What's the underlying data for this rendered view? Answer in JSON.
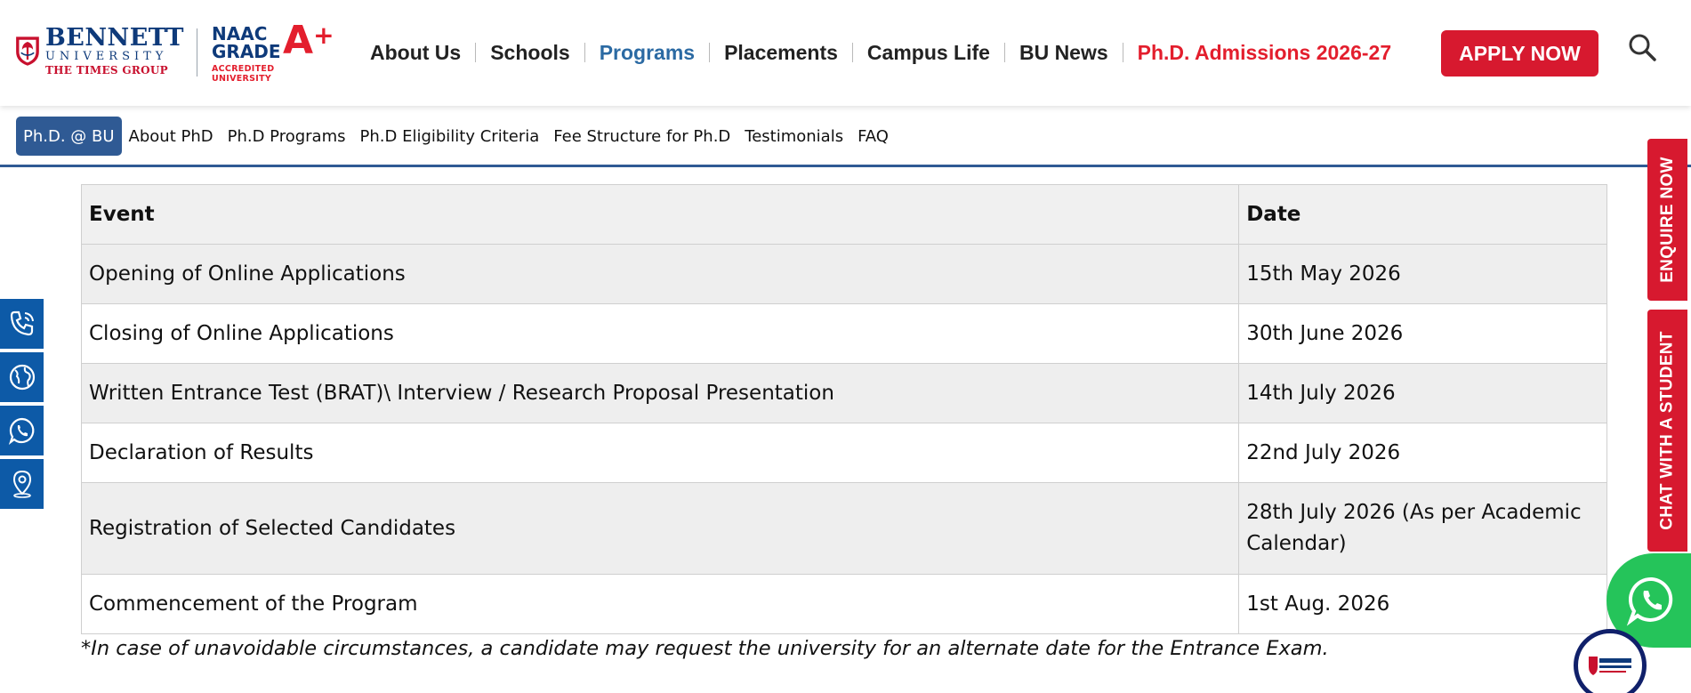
{
  "header": {
    "logo": {
      "line1": "BENNETT",
      "line2": "UNIVERSITY",
      "line3": "THE TIMES GROUP"
    },
    "naac": {
      "line1": "NAAC",
      "line2": "GRADE",
      "grade": "A",
      "plus": "+",
      "line3": "ACCREDITED UNIVERSITY"
    },
    "nav": [
      {
        "label": "About Us"
      },
      {
        "label": "Schools"
      },
      {
        "label": "Programs"
      },
      {
        "label": "Placements"
      },
      {
        "label": "Campus Life"
      },
      {
        "label": "BU News"
      }
    ],
    "admission_link": "Ph.D. Admissions 2026-27",
    "apply_label": "APPLY NOW"
  },
  "subnav": [
    {
      "label": "Ph.D. @ BU"
    },
    {
      "label": "About PhD"
    },
    {
      "label": "Ph.D Programs"
    },
    {
      "label": "Ph.D Eligibility Criteria"
    },
    {
      "label": "Fee Structure for Ph.D"
    },
    {
      "label": "Testimonials"
    },
    {
      "label": "FAQ"
    }
  ],
  "table": {
    "headers": {
      "event": "Event",
      "date": "Date"
    },
    "rows": [
      {
        "event": "Opening of Online Applications",
        "date": "15th May 2026"
      },
      {
        "event": "Closing of Online Applications",
        "date": "30th June 2026"
      },
      {
        "event": "Written Entrance Test (BRAT)\\ Interview / Research Proposal Presentation",
        "date": "14th July 2026"
      },
      {
        "event": "Declaration of Results",
        "date": "22nd July 2026"
      },
      {
        "event": "Registration of Selected Candidates",
        "date": "28th July 2026 (As per Academic Calendar)"
      },
      {
        "event": "Commencement of the Program",
        "date": "1st Aug. 2026"
      }
    ]
  },
  "note": "*In case of unavoidable circumstances, a candidate may request the university for an alternate date for the Entrance Exam.",
  "side_tabs": {
    "enquire": "ENQUIRE NOW",
    "chat": "CHAT WITH A STUDENT"
  },
  "left_icons": [
    "phone-icon",
    "globe-icon",
    "whatsapp-icon",
    "location-pin-icon"
  ],
  "colors": {
    "brand_blue": "#2f5a94",
    "brand_red": "#d7192f",
    "nav_active": "#2b6aa3",
    "whatsapp_green": "#25c45a",
    "social_blue": "#0d5aa7"
  }
}
